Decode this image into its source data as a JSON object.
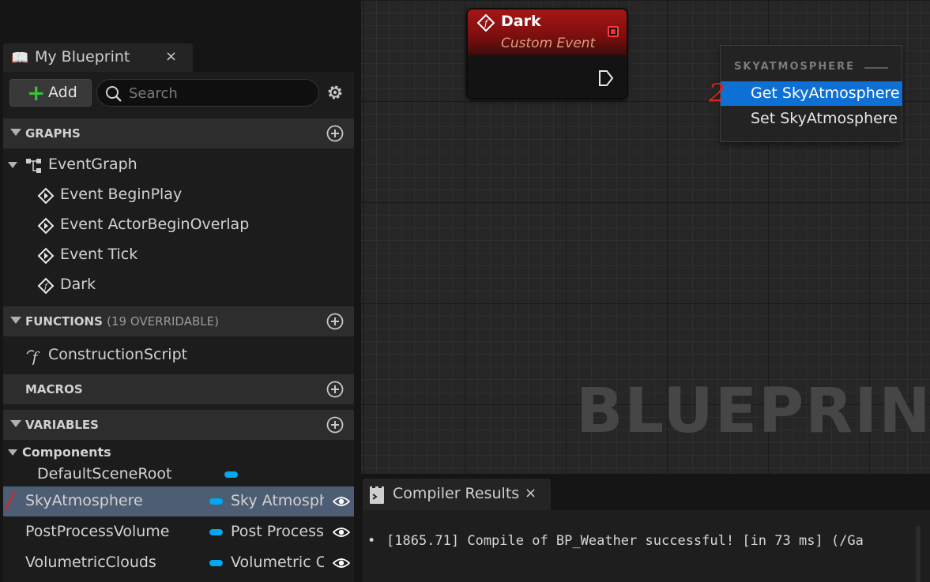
{
  "panel": {
    "tab_title": "My Blueprint",
    "tab_close": "×",
    "add_label": "Add",
    "search_placeholder": "Search"
  },
  "sections": {
    "graphs": "GRAPHS",
    "functions": "FUNCTIONS",
    "functions_count": "(19 OVERRIDABLE)",
    "macros": "MACROS",
    "variables": "VARIABLES"
  },
  "graphs": {
    "event_graph": "EventGraph",
    "events": [
      "Event BeginPlay",
      "Event ActorBeginOverlap",
      "Event Tick",
      "Dark"
    ]
  },
  "functions": {
    "items": [
      "ConstructionScript"
    ]
  },
  "variables": {
    "category": "Components",
    "items": [
      {
        "name": "DefaultSceneRoot",
        "type": ""
      },
      {
        "name": "SkyAtmosphere",
        "type": "Sky Atmosph"
      },
      {
        "name": "PostProcessVolume",
        "type": "Post Process"
      },
      {
        "name": "VolumetricClouds",
        "type": "Volumetric Cl"
      }
    ]
  },
  "node": {
    "title": "Dark",
    "subtitle": "Custom Event"
  },
  "popup": {
    "heading": "SKYATMOSPHERE",
    "items": [
      "Get SkyAtmosphere",
      "Set SkyAtmosphere"
    ],
    "selected_index": 0
  },
  "annotations": {
    "mark_1": "/",
    "mark_2": "2"
  },
  "graph": {
    "watermark": "BLUEPRINT"
  },
  "compiler": {
    "tab_title": "Compiler Results",
    "tab_close": "×",
    "bullet": "•",
    "message": "[1865.71] Compile of BP_Weather successful! [in 73 ms] (/Ga"
  },
  "colors": {
    "selection_blue": "#0e70d4",
    "selected_row": "#4d5d73",
    "event_red": "#a51616",
    "component_pill": "#00a8f0",
    "add_green": "#38c03a"
  }
}
